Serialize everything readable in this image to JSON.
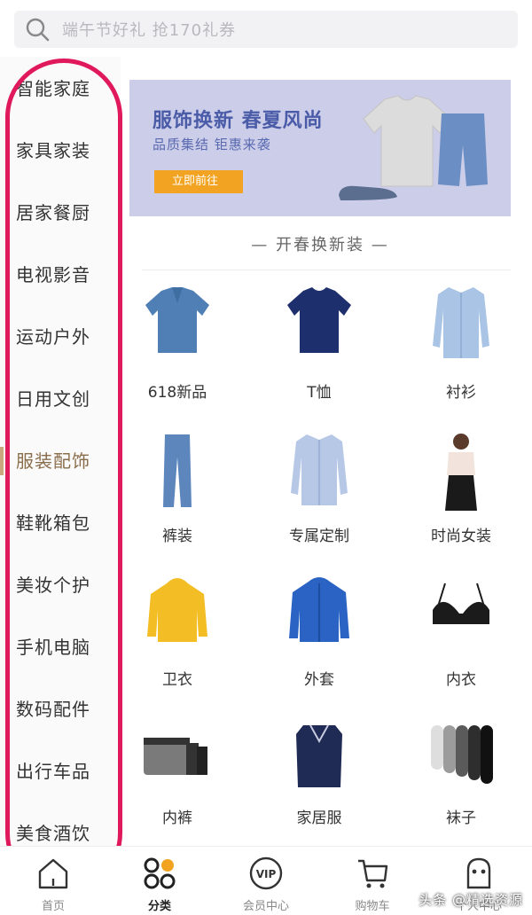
{
  "search": {
    "placeholder": "端午节好礼 抢170礼券"
  },
  "sidebar": {
    "items": [
      {
        "label": "智能家庭"
      },
      {
        "label": "家具家装"
      },
      {
        "label": "居家餐厨"
      },
      {
        "label": "电视影音"
      },
      {
        "label": "运动户外"
      },
      {
        "label": "日用文创"
      },
      {
        "label": "服装配饰"
      },
      {
        "label": "鞋靴箱包"
      },
      {
        "label": "美妆个护"
      },
      {
        "label": "手机电脑"
      },
      {
        "label": "数码配件"
      },
      {
        "label": "出行车品"
      },
      {
        "label": "美食酒饮"
      }
    ],
    "active_label": "服装配饰"
  },
  "banner": {
    "title": "服饰换新 春夏风尚",
    "subtitle": "品质集结 钜惠来袭",
    "button": "立即前往"
  },
  "section": {
    "title": "— 开春换新装 —"
  },
  "grid": [
    {
      "label": "618新品",
      "icon": "polo-shirt-icon"
    },
    {
      "label": "T恤",
      "icon": "tshirt-icon"
    },
    {
      "label": "衬衫",
      "icon": "shirt-icon"
    },
    {
      "label": "裤装",
      "icon": "jeans-icon"
    },
    {
      "label": "专属定制",
      "icon": "dress-shirt-icon"
    },
    {
      "label": "时尚女装",
      "icon": "womens-fashion-icon"
    },
    {
      "label": "卫衣",
      "icon": "hoodie-icon"
    },
    {
      "label": "外套",
      "icon": "jacket-icon"
    },
    {
      "label": "内衣",
      "icon": "bra-icon"
    },
    {
      "label": "内裤",
      "icon": "underwear-icon"
    },
    {
      "label": "家居服",
      "icon": "pajamas-icon"
    },
    {
      "label": "袜子",
      "icon": "socks-icon"
    }
  ],
  "tabbar": [
    {
      "label": "首页",
      "icon": "home-icon"
    },
    {
      "label": "分类",
      "icon": "category-icon"
    },
    {
      "label": "会员中心",
      "icon": "vip-icon"
    },
    {
      "label": "购物车",
      "icon": "cart-icon"
    },
    {
      "label": "个人中心",
      "icon": "profile-icon"
    }
  ],
  "watermark": "头条 @精选资源",
  "colors": {
    "accent": "#e0185c",
    "active_text": "#8a6d4b",
    "banner_bg": "#cccde8",
    "button": "#f2a321"
  }
}
